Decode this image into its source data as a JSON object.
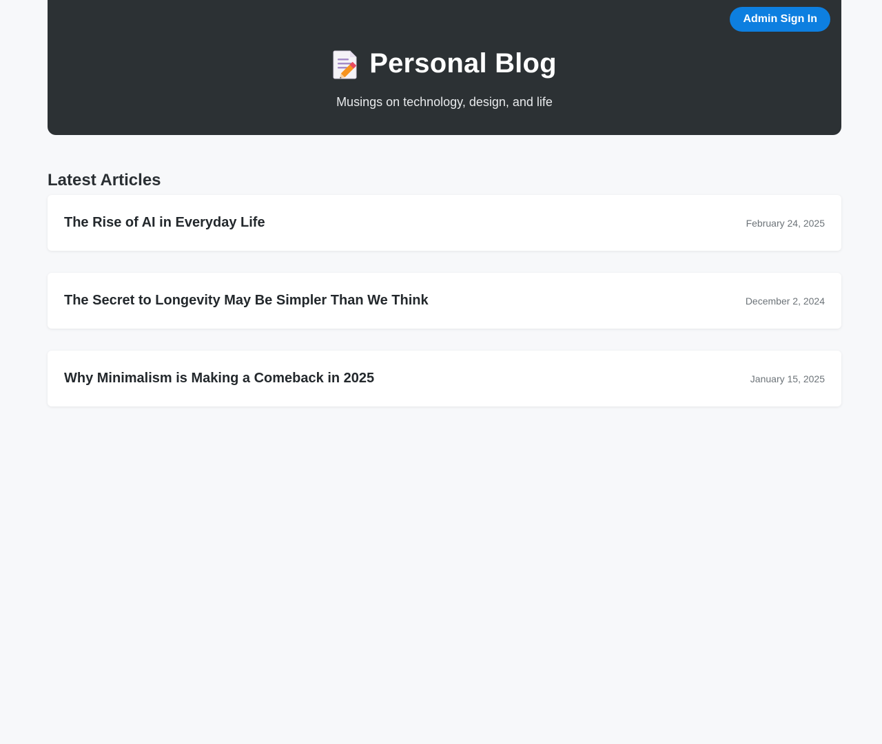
{
  "header": {
    "admin_button": "Admin Sign In",
    "title": "Personal Blog",
    "tagline": "Musings on technology, design, and life",
    "icon": "memo-icon"
  },
  "main": {
    "section_title": "Latest Articles",
    "articles": [
      {
        "title": "The Rise of AI in Everyday Life",
        "date": "February 24, 2025"
      },
      {
        "title": "The Secret to Longevity May Be Simpler Than We Think",
        "date": "December 2, 2024"
      },
      {
        "title": "Why Minimalism is Making a Comeback in 2025",
        "date": "January 15, 2025"
      }
    ]
  },
  "colors": {
    "header_bg": "#2c3134",
    "accent": "#0d7fe0",
    "page_bg": "#f7f8fa"
  }
}
